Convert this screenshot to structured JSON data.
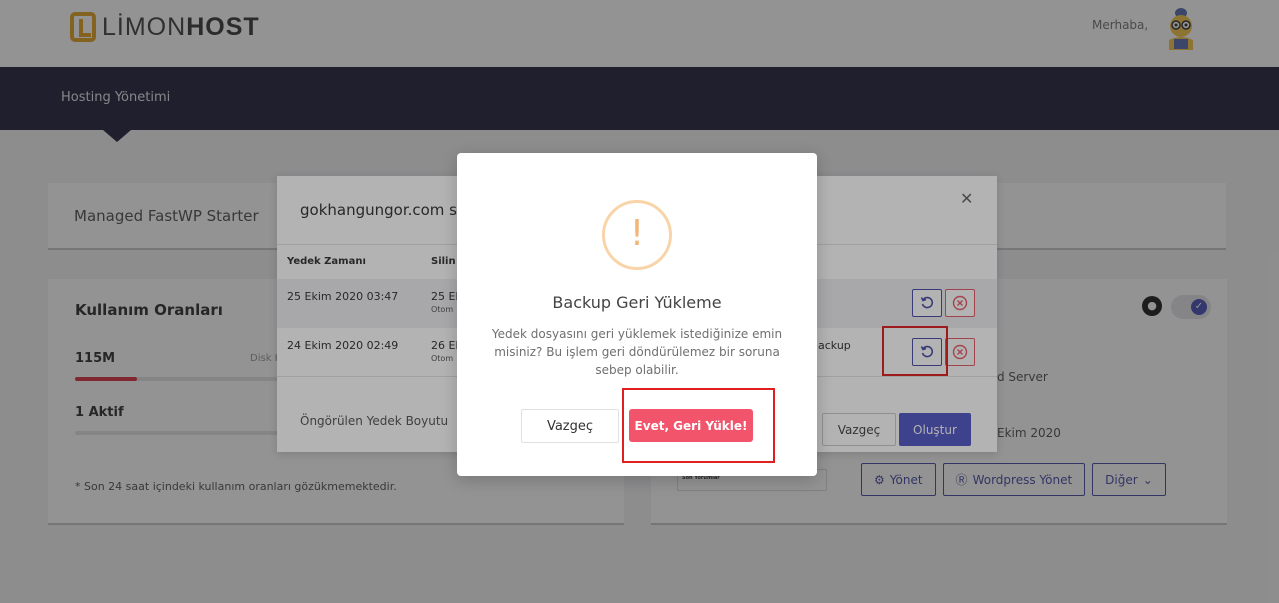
{
  "header": {
    "logo_light": "LİMON",
    "logo_bold": "HOST",
    "greeting": "Merhaba,"
  },
  "nav": {
    "active_item": "Hosting Yönetimi"
  },
  "product": {
    "name": "Managed FastWP Starter"
  },
  "usage": {
    "title": "Kullanım Oranları",
    "disk_value": "115M",
    "disk_label": "Disk K",
    "disk_fraction": 0.115,
    "active_value": "1 Aktif",
    "note": "* Son 24 saat içindeki kullanım oranları gözükmemektedir."
  },
  "right_panel": {
    "server_text": "d Server",
    "date_text": "Ekim 2020",
    "thumb_text": "Son Yorumlar",
    "buttons": {
      "manage": "Yönet",
      "wp_manage": "Wordpress Yönet",
      "other": "Diğer"
    }
  },
  "backup_modal": {
    "title": "gokhangungor.com s",
    "columns": {
      "time": "Yedek Zamanı",
      "deleted": "Silin"
    },
    "rows": [
      {
        "date": "25 Ekim 2020 03:47",
        "deleted": "25 Ek",
        "sub": "Otom",
        "type": ""
      },
      {
        "date": "24 Ekim 2020 02:49",
        "deleted": "26 Ek",
        "sub": "Otom",
        "type": "ackup"
      }
    ],
    "footer_label": "Öngörülen Yedek Boyutu",
    "cancel": "Vazgeç",
    "create": "Oluştur"
  },
  "confirm_modal": {
    "icon": "!",
    "title": "Backup Geri Yükleme",
    "text": "Yedek dosyasını geri yüklemek istediğinize emin misiniz? Bu işlem geri döndürülemez bir soruna sebep olabilir.",
    "cancel": "Vazgeç",
    "confirm": "Evet, Geri Yükle!"
  },
  "colors": {
    "navbar": "#252440",
    "primary": "#5357c4",
    "danger": "#f2546c",
    "warning": "#f3b67a",
    "highlight": "#e02020"
  }
}
